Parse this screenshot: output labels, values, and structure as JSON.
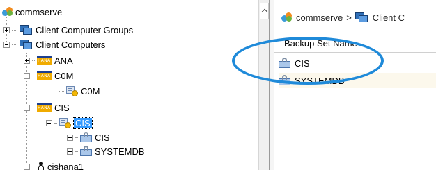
{
  "tree": {
    "root_label": "commserve",
    "groups_label": "Client Computer Groups",
    "clients_label": "Client Computers",
    "ana_label": "ANA",
    "c0m_label": "C0M",
    "c0m_instance_label": "C0M",
    "cis_label": "CIS",
    "cis_instance_label": "CIS",
    "cis_bs1_label": "CIS",
    "cis_bs2_label": "SYSTEMDB",
    "cishana_label": "cishana1"
  },
  "breadcrumb": {
    "root": "commserve",
    "separator": ">",
    "current": "Client C"
  },
  "list": {
    "column_header": "Backup Set Name",
    "rows": [
      "CIS",
      "SYSTEMDB"
    ]
  },
  "colors": {
    "highlight_oval": "#1f8ad9",
    "selection": "#3399ff",
    "hana_orange": "#f0ab00"
  }
}
